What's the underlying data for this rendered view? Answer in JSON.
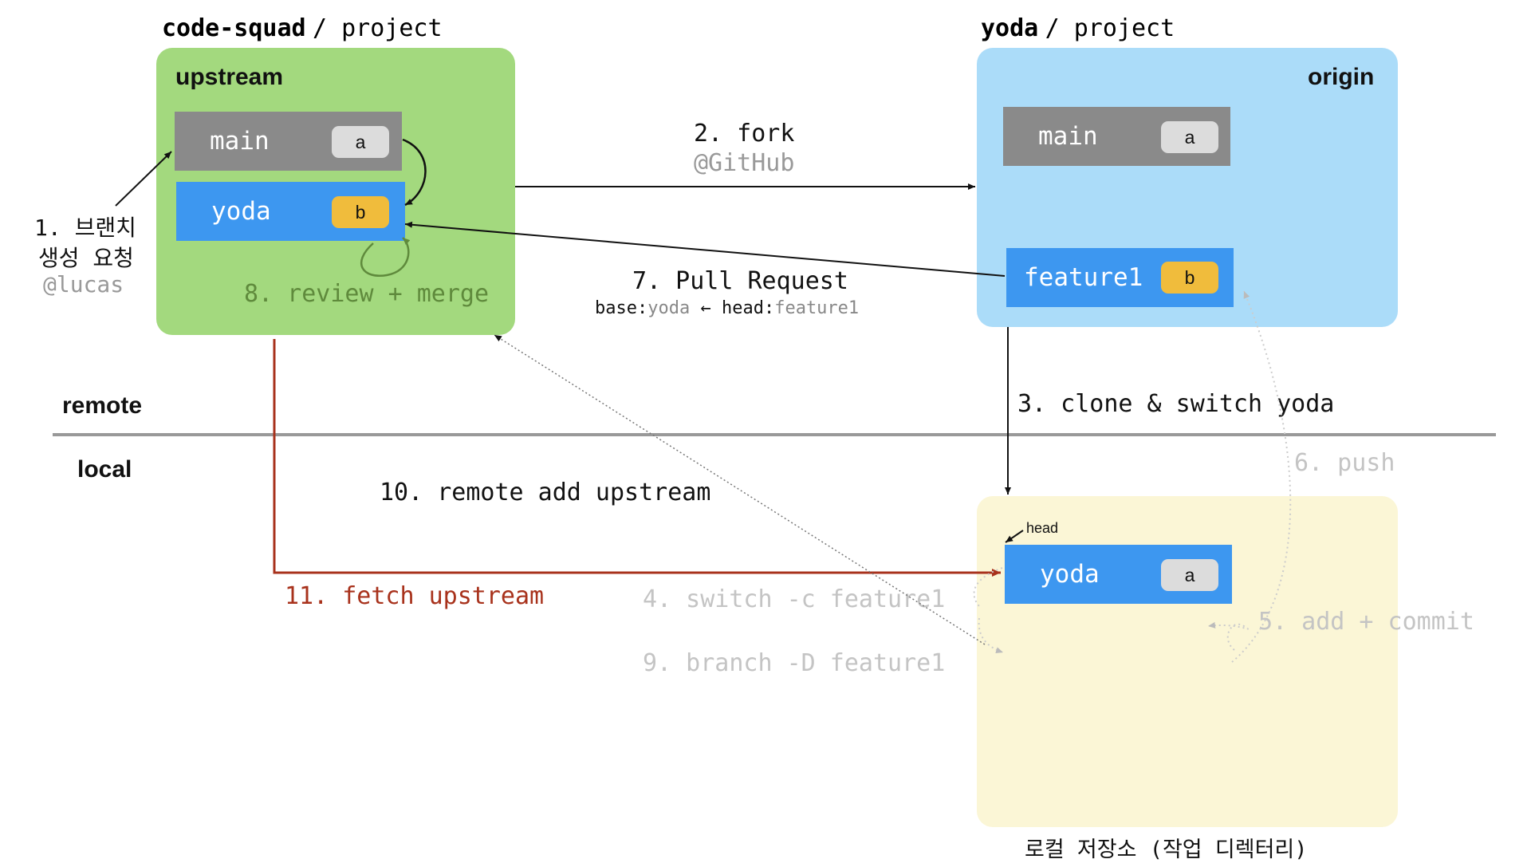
{
  "remote_label": "remote",
  "local_label": "local",
  "upstream_repo": {
    "owner": "code-squad",
    "repo": "/ project",
    "title": "upstream",
    "branches": [
      {
        "name": "main",
        "commit": "a"
      },
      {
        "name": "yoda",
        "commit": "b"
      }
    ],
    "step_review": "8. review + merge"
  },
  "origin_repo": {
    "owner": "yoda",
    "repo": "/ project",
    "title": "origin",
    "branches": [
      {
        "name": "main",
        "commit": "a"
      },
      {
        "name": "feature1",
        "commit": "b"
      }
    ]
  },
  "local_repo": {
    "head_label": "head",
    "branch": {
      "name": "yoda",
      "commit": "a"
    },
    "caption": "로컬 저장소 (작업 디렉터리)"
  },
  "steps": {
    "s1_line1": "1. 브랜치",
    "s1_line2": "생성 요청",
    "s1_actor": "@lucas",
    "s2_action": "2. fork",
    "s2_actor": "@GitHub",
    "s3": "3. clone & switch yoda",
    "s4": "4. switch -c feature1",
    "s5": "5. add + commit",
    "s6": "6. push",
    "s7": "7. Pull Request",
    "s7_base_key": "base:",
    "s7_base_val": "yoda",
    "s7_arrow": "←",
    "s7_head_key": "head:",
    "s7_head_val": "feature1",
    "s9": "9. branch -D feature1",
    "s10": "10. remote add upstream",
    "s11": "11. fetch upstream"
  },
  "colors": {
    "upstream_bg": "#a3d97e",
    "origin_bg": "#abdcf9",
    "local_bg": "#fbf6d6",
    "branch_gray": "#8a8a8a",
    "branch_blue": "#3d97f0",
    "tag_gray": "#dcdcdc",
    "tag_yellow": "#f0bc3c",
    "step_red": "#a8321c",
    "step_green": "#5f8a3c",
    "step_faded": "#c4c4c4"
  }
}
